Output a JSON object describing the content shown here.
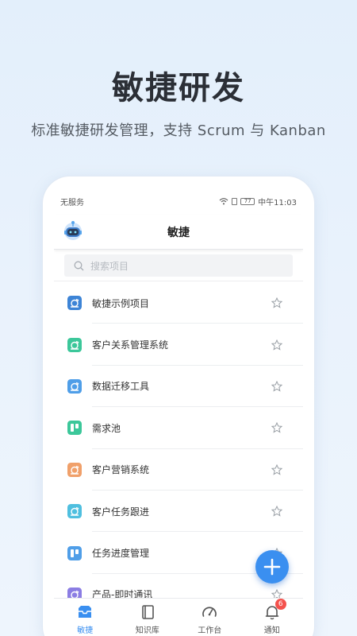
{
  "hero": {
    "title": "敏捷研发",
    "subtitle": "标准敏捷研发管理，支持 Scrum 与 Kanban"
  },
  "status_bar": {
    "carrier": "无服务",
    "battery": "77",
    "time": "中午11:03"
  },
  "header": {
    "title": "敏捷"
  },
  "search": {
    "placeholder": "搜索项目"
  },
  "projects": [
    {
      "label": "敏捷示例项目",
      "icon": "scrum-icon",
      "color": "#3d84d6"
    },
    {
      "label": "客户关系管理系统",
      "icon": "scrum-icon",
      "color": "#3cc79a"
    },
    {
      "label": "数据迁移工具",
      "icon": "scrum-icon",
      "color": "#4f9ee8"
    },
    {
      "label": "需求池",
      "icon": "kanban-icon",
      "color": "#3cc79a"
    },
    {
      "label": "客户营销系统",
      "icon": "scrum-icon",
      "color": "#f0a06a"
    },
    {
      "label": "客户任务跟进",
      "icon": "scrum-icon",
      "color": "#4fbfdf"
    },
    {
      "label": "任务进度管理",
      "icon": "kanban-icon",
      "color": "#4f9ee8"
    },
    {
      "label": "产品-即时通讯",
      "icon": "scrum-icon",
      "color": "#8b7de3"
    }
  ],
  "tabs": [
    {
      "label": "敏捷",
      "icon": "inbox-icon",
      "active": true
    },
    {
      "label": "知识库",
      "icon": "book-icon",
      "active": false
    },
    {
      "label": "工作台",
      "icon": "gauge-icon",
      "active": false
    },
    {
      "label": "通知",
      "icon": "bell-icon",
      "active": false,
      "badge": "6"
    }
  ],
  "colors": {
    "accent": "#3a8ff0",
    "badge": "#f4524d"
  }
}
